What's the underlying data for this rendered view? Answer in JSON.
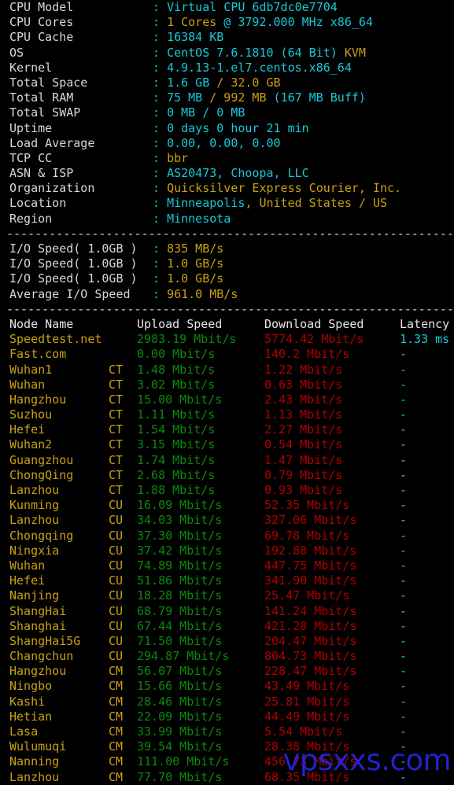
{
  "terminal": {
    "background": "#000000",
    "colors": {
      "label": "#d8d8d8",
      "cyan": "#18c8d8",
      "yellow": "#c8a015",
      "green": "#0a8a0a",
      "red": "#b00000",
      "white": "#e6e6e6",
      "watermark": "#2222cc"
    },
    "separator": "------------------------------------------------------------"
  },
  "sysinfo": [
    {
      "label": "CPU Model",
      "colon": ":",
      "parts": [
        {
          "t": "Virtual CPU 6db7dc0e7704",
          "c": "cyan"
        }
      ]
    },
    {
      "label": "CPU Cores",
      "colon": ":",
      "parts": [
        {
          "t": "1 Cores",
          "c": "yellow"
        },
        {
          "t": " @ 3792.000 MHz x86_64",
          "c": "cyan"
        }
      ]
    },
    {
      "label": "CPU Cache",
      "colon": ":",
      "parts": [
        {
          "t": "16384 KB",
          "c": "cyan"
        }
      ]
    },
    {
      "label": "OS",
      "colon": ":",
      "parts": [
        {
          "t": "CentOS 7.6.1810 (64 Bit) ",
          "c": "cyan"
        },
        {
          "t": "KVM",
          "c": "yellow"
        }
      ]
    },
    {
      "label": "Kernel",
      "colon": ":",
      "parts": [
        {
          "t": "4.9.13-1.el7.centos.x86_64",
          "c": "cyan"
        }
      ]
    },
    {
      "label": "Total Space",
      "colon": ":",
      "parts": [
        {
          "t": "1.6 GB ",
          "c": "cyan"
        },
        {
          "t": "/ 32.0 GB",
          "c": "yellow"
        }
      ]
    },
    {
      "label": "Total RAM",
      "colon": ":",
      "parts": [
        {
          "t": "75 MB ",
          "c": "cyan"
        },
        {
          "t": "/ 992 MB ",
          "c": "yellow"
        },
        {
          "t": "(167 MB Buff)",
          "c": "cyan"
        }
      ]
    },
    {
      "label": "Total SWAP",
      "colon": ":",
      "parts": [
        {
          "t": "0 MB / 0 MB",
          "c": "cyan"
        }
      ]
    },
    {
      "label": "Uptime",
      "colon": ":",
      "parts": [
        {
          "t": "0 days 0 hour 21 min",
          "c": "cyan"
        }
      ]
    },
    {
      "label": "Load Average",
      "colon": ":",
      "parts": [
        {
          "t": "0.00, 0.00, 0.00",
          "c": "cyan"
        }
      ]
    },
    {
      "label": "TCP CC",
      "colon": ":",
      "parts": [
        {
          "t": "bbr",
          "c": "yellow"
        }
      ]
    },
    {
      "label": "ASN & ISP",
      "colon": ":",
      "parts": [
        {
          "t": "AS20473, Choopa, LLC",
          "c": "cyan"
        }
      ]
    },
    {
      "label": "Organization",
      "colon": ":",
      "parts": [
        {
          "t": "Quicksilver Express Courier, Inc.",
          "c": "yellow"
        }
      ]
    },
    {
      "label": "Location",
      "colon": ":",
      "parts": [
        {
          "t": "Minneapolis",
          "c": "cyan"
        },
        {
          "t": ", United States / US",
          "c": "yellow"
        }
      ]
    },
    {
      "label": "Region",
      "colon": ":",
      "parts": [
        {
          "t": "Minnesota",
          "c": "cyan"
        }
      ]
    }
  ],
  "iospeed": [
    {
      "label": "I/O Speed( 1.0GB )",
      "colon": ":",
      "value": "835 MB/s"
    },
    {
      "label": "I/O Speed( 1.0GB )",
      "colon": ":",
      "value": "1.0 GB/s"
    },
    {
      "label": "I/O Speed( 1.0GB )",
      "colon": ":",
      "value": "1.0 GB/s"
    },
    {
      "label": "Average I/O Speed",
      "colon": ":",
      "value": "961.0 MB/s"
    }
  ],
  "speedtest": {
    "headers": {
      "node": "Node Name",
      "upload": "Upload Speed",
      "download": "Download Speed",
      "latency": "Latency"
    },
    "rows": [
      {
        "node": "Speedtest.net",
        "isp": "",
        "upload": "2983.19 Mbit/s",
        "download": "5774.42 Mbit/s",
        "latency": "1.33 ms"
      },
      {
        "node": "Fast.com",
        "isp": "",
        "upload": "0.00 Mbit/s",
        "download": "140.2 Mbit/s",
        "latency": "-"
      },
      {
        "node": "Wuhan1",
        "isp": "CT",
        "upload": "1.48 Mbit/s",
        "download": "1.22 Mbit/s",
        "latency": "-"
      },
      {
        "node": "Wuhan",
        "isp": "CT",
        "upload": "3.02 Mbit/s",
        "download": "0.63 Mbit/s",
        "latency": "-"
      },
      {
        "node": "Hangzhou",
        "isp": "CT",
        "upload": "15.00 Mbit/s",
        "download": "2.43 Mbit/s",
        "latency": "-"
      },
      {
        "node": "Suzhou",
        "isp": "CT",
        "upload": "1.11 Mbit/s",
        "download": "1.13 Mbit/s",
        "latency": "-"
      },
      {
        "node": "Hefei",
        "isp": "CT",
        "upload": "1.54 Mbit/s",
        "download": "2.27 Mbit/s",
        "latency": "-"
      },
      {
        "node": "Wuhan2",
        "isp": "CT",
        "upload": "3.15 Mbit/s",
        "download": "0.54 Mbit/s",
        "latency": "-"
      },
      {
        "node": "Guangzhou",
        "isp": "CT",
        "upload": "1.74 Mbit/s",
        "download": "1.47 Mbit/s",
        "latency": "-"
      },
      {
        "node": "ChongQing",
        "isp": "CT",
        "upload": "2.68 Mbit/s",
        "download": "0.79 Mbit/s",
        "latency": "-"
      },
      {
        "node": "Lanzhou",
        "isp": "CT",
        "upload": "1.88 Mbit/s",
        "download": "0.93 Mbit/s",
        "latency": "-"
      },
      {
        "node": "Kunming",
        "isp": "CU",
        "upload": "16.09 Mbit/s",
        "download": "52.35 Mbit/s",
        "latency": "-"
      },
      {
        "node": "Lanzhou",
        "isp": "CU",
        "upload": "34.03 Mbit/s",
        "download": "327.06 Mbit/s",
        "latency": "-"
      },
      {
        "node": "Chongqing",
        "isp": "CU",
        "upload": "37.30 Mbit/s",
        "download": "69.78 Mbit/s",
        "latency": "-"
      },
      {
        "node": "Ningxia",
        "isp": "CU",
        "upload": "37.42 Mbit/s",
        "download": "192.88 Mbit/s",
        "latency": "-"
      },
      {
        "node": "Wuhan",
        "isp": "CU",
        "upload": "74.89 Mbit/s",
        "download": "447.75 Mbit/s",
        "latency": "-"
      },
      {
        "node": "Hefei",
        "isp": "CU",
        "upload": "51.86 Mbit/s",
        "download": "341.90 Mbit/s",
        "latency": "-"
      },
      {
        "node": "Nanjing",
        "isp": "CU",
        "upload": "18.28 Mbit/s",
        "download": "25.47 Mbit/s",
        "latency": "-"
      },
      {
        "node": "ShangHai",
        "isp": "CU",
        "upload": "68.79 Mbit/s",
        "download": "141.24 Mbit/s",
        "latency": "-"
      },
      {
        "node": "Shanghai",
        "isp": "CU",
        "upload": "67.44 Mbit/s",
        "download": "421.28 Mbit/s",
        "latency": "-"
      },
      {
        "node": "ShangHai5G",
        "isp": "CU",
        "upload": "71.50 Mbit/s",
        "download": "204.47 Mbit/s",
        "latency": "-"
      },
      {
        "node": "Changchun",
        "isp": "CU",
        "upload": "294.87 Mbit/s",
        "download": "804.73 Mbit/s",
        "latency": "-"
      },
      {
        "node": "Hangzhou",
        "isp": "CM",
        "upload": "56.07 Mbit/s",
        "download": "228.47 Mbit/s",
        "latency": "-"
      },
      {
        "node": "Ningbo",
        "isp": "CM",
        "upload": "15.66 Mbit/s",
        "download": "43.49 Mbit/s",
        "latency": "-"
      },
      {
        "node": "Kashi",
        "isp": "CM",
        "upload": "28.46 Mbit/s",
        "download": "25.81 Mbit/s",
        "latency": "-"
      },
      {
        "node": "Hetian",
        "isp": "CM",
        "upload": "22.09 Mbit/s",
        "download": "44.49 Mbit/s",
        "latency": "-"
      },
      {
        "node": "Lasa",
        "isp": "CM",
        "upload": "33.99 Mbit/s",
        "download": "5.54 Mbit/s",
        "latency": "-"
      },
      {
        "node": "Wulumuqi",
        "isp": "CM",
        "upload": "39.54 Mbit/s",
        "download": "28.38 Mbit/s",
        "latency": "-"
      },
      {
        "node": "Nanning",
        "isp": "CM",
        "upload": "111.00 Mbit/s",
        "download": "456.73 Mbit/s",
        "latency": "-"
      },
      {
        "node": "Lanzhou",
        "isp": "CM",
        "upload": "77.70 Mbit/s",
        "download": "68.35 Mbit/s",
        "latency": "-"
      }
    ]
  },
  "watermark": {
    "text": "vpsxxs.com"
  }
}
